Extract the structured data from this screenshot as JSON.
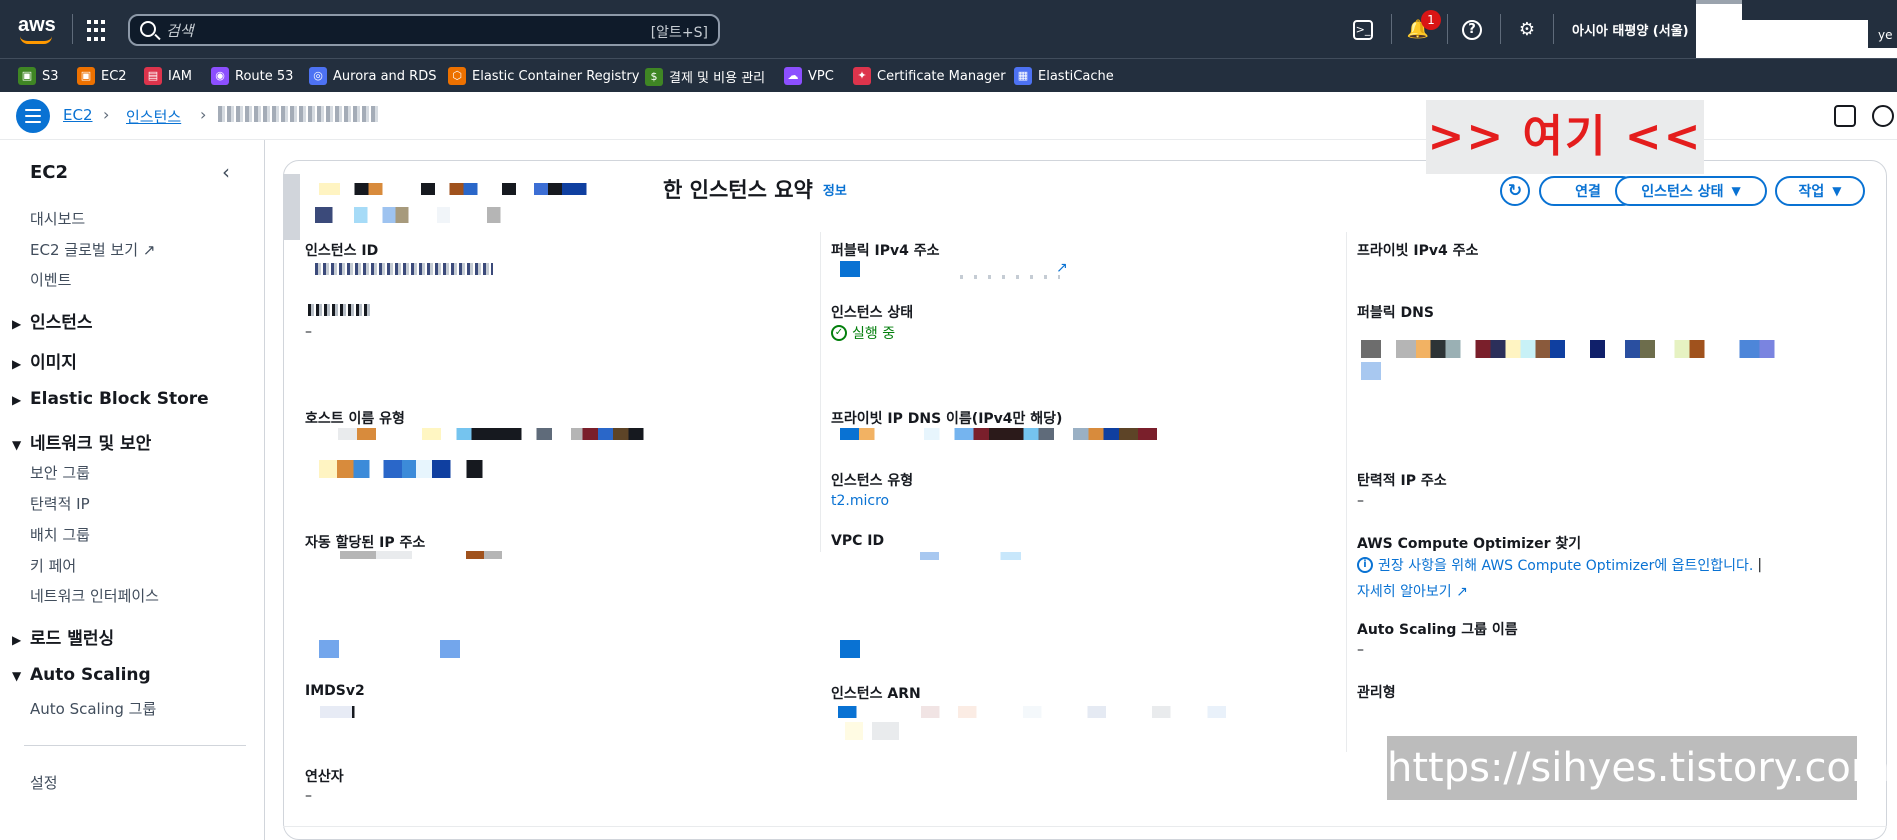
{
  "topnav": {
    "logo": "aws",
    "search_placeholder": "검색",
    "search_shortcut": "[알트+S]",
    "notification_count": "1",
    "region": "아시아 태평양 (서울)",
    "user_fragment": "ye"
  },
  "favorites": [
    {
      "label": "S3",
      "color": "#3f8624"
    },
    {
      "label": "EC2",
      "color": "#ed7100"
    },
    {
      "label": "IAM",
      "color": "#dd344c"
    },
    {
      "label": "Route 53",
      "color": "#8c4fff"
    },
    {
      "label": "Aurora and RDS",
      "color": "#4d72f3"
    },
    {
      "label": "Elastic Container Registry",
      "color": "#ed7100"
    },
    {
      "label": "결제 및 비용 관리",
      "color": "#3f8624"
    },
    {
      "label": "VPC",
      "color": "#8c4fff"
    },
    {
      "label": "Certificate Manager",
      "color": "#dd344c"
    },
    {
      "label": "ElastiCache",
      "color": "#4d72f3"
    }
  ],
  "breadcrumb": {
    "root": "EC2",
    "section": "인스턴스"
  },
  "annotation": ">> 여기 <<",
  "sidebar": {
    "title": "EC2",
    "top_items": [
      "대시보드",
      "EC2 글로벌 보기",
      "이벤트"
    ],
    "sections": {
      "instances": "인스턴스",
      "images": "이미지",
      "ebs": "Elastic Block Store",
      "network": "네트워크 및 보안",
      "load_balancing": "로드 밸런싱",
      "auto_scaling": "Auto Scaling"
    },
    "network_items": [
      "보안 그룹",
      "탄력적 IP",
      "배치 그룹",
      "키 페어",
      "네트워크 인터페이스"
    ],
    "auto_scaling_items": [
      "Auto Scaling 그룹"
    ],
    "settings": "설정"
  },
  "panel": {
    "title": "한 인스턴스 요약",
    "info": "정보",
    "buttons": {
      "connect": "연결",
      "instance_state": "인스턴스 상태",
      "actions": "작업"
    }
  },
  "fields": {
    "instance_id": "인스턴스 ID",
    "public_ipv4": "퍼블릭 IPv4 주소",
    "private_ipv4": "프라이빗 IPv4 주소",
    "instance_status_label": "인스턴스 상태",
    "instance_status_value": "실행 중",
    "public_dns": "퍼블릭 DNS",
    "ipv6_value": "–",
    "host_name_type": "호스트 이름 유형",
    "private_ip_dns": "프라이빗 IP DNS 이름(IPv4만 해당)",
    "instance_type_label": "인스턴스 유형",
    "instance_type_value": "t2.micro",
    "elastic_ip_label": "탄력적 IP 주소",
    "elastic_ip_value": "–",
    "auto_ip": "자동 할당된 IP 주소",
    "vpc_id": "VPC ID",
    "optimizer_label": "AWS Compute Optimizer 찾기",
    "optimizer_link": "권장 사항을 위해 AWS Compute Optimizer에 옵트인합니다.",
    "learn_more": "자세히 알아보기",
    "asg_label": "Auto Scaling 그룹 이름",
    "asg_value": "–",
    "imdsv2": "IMDSv2",
    "instance_arn": "인스턴스 ARN",
    "managed_label": "관리형",
    "operator_label": "연산자",
    "operator_value": "–"
  },
  "watermark": "https://sihyes.tistory.com",
  "colors": {
    "nav_bg": "#232f3e",
    "link": "#0972d3",
    "success": "#037f0c",
    "annotation": "#e41d1d"
  }
}
